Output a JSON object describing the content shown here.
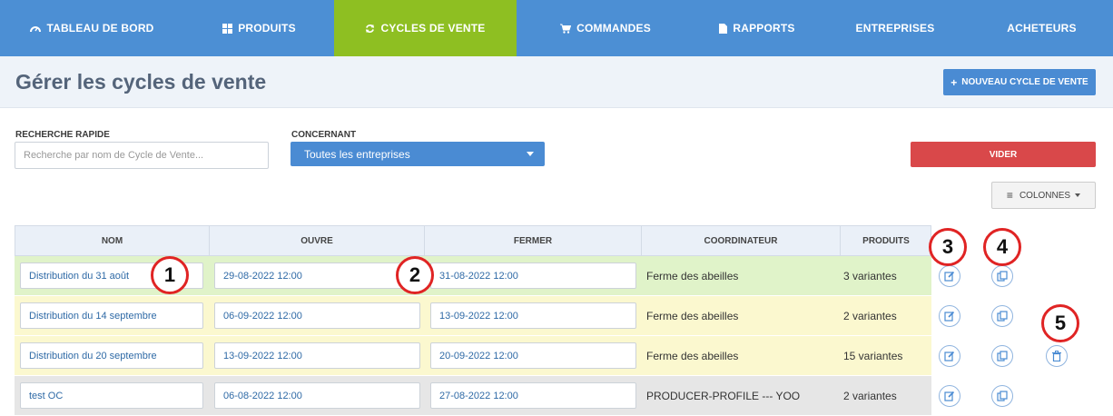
{
  "nav": {
    "items": [
      {
        "label": "TABLEAU DE BORD",
        "icon": "dashboard-icon"
      },
      {
        "label": "PRODUITS",
        "icon": "grid-icon"
      },
      {
        "label": "CYCLES DE VENTE",
        "icon": "refresh-icon",
        "active": true
      },
      {
        "label": "COMMANDES",
        "icon": "cart-icon"
      },
      {
        "label": "RAPPORTS",
        "icon": "file-icon"
      },
      {
        "label": "ENTREPRISES",
        "icon": ""
      },
      {
        "label": "ACHETEURS",
        "icon": ""
      }
    ]
  },
  "header": {
    "title": "Gérer les cycles de vente",
    "new_button": "NOUVEAU CYCLE DE VENTE"
  },
  "filters": {
    "search_label": "RECHERCHE RAPIDE",
    "search_placeholder": "Recherche par nom de Cycle de Vente...",
    "concerning_label": "CONCERNANT",
    "concerning_value": "Toutes les entreprises",
    "clear_button": "VIDER",
    "columns_button": "COLONNES"
  },
  "table": {
    "headers": [
      "NOM",
      "OUVRE",
      "FERMER",
      "COORDINATEUR",
      "PRODUITS"
    ],
    "rows": [
      {
        "name": "Distribution du 31 août",
        "opens": "29-08-2022 12:00",
        "closes": "31-08-2022 12:00",
        "coordinator": "Ferme des abeilles",
        "products": "3 variantes",
        "status": "green",
        "deletable": false
      },
      {
        "name": "Distribution du 14 septembre",
        "opens": "06-09-2022 12:00",
        "closes": "13-09-2022 12:00",
        "coordinator": "Ferme des abeilles",
        "products": "2 variantes",
        "status": "yellow",
        "deletable": false
      },
      {
        "name": "Distribution du 20 septembre",
        "opens": "13-09-2022 12:00",
        "closes": "20-09-2022 12:00",
        "coordinator": "Ferme des abeilles",
        "products": "15 variantes",
        "status": "yellow",
        "deletable": true
      },
      {
        "name": "test OC",
        "opens": "06-08-2022 12:00",
        "closes": "27-08-2022 12:00",
        "coordinator": "PRODUCER-PROFILE --- YOO",
        "products": "2 variantes",
        "status": "grey",
        "deletable": false
      }
    ]
  },
  "annotations": [
    "1",
    "2",
    "3",
    "4",
    "5"
  ],
  "colors": {
    "nav_bg": "#4c8fd4",
    "nav_active": "#8ebf22",
    "row_green": "#e0f3c9",
    "row_yellow": "#fbf8cf",
    "row_grey": "#e6e6e6",
    "danger": "#d9484a",
    "annotation": "#e02424"
  }
}
